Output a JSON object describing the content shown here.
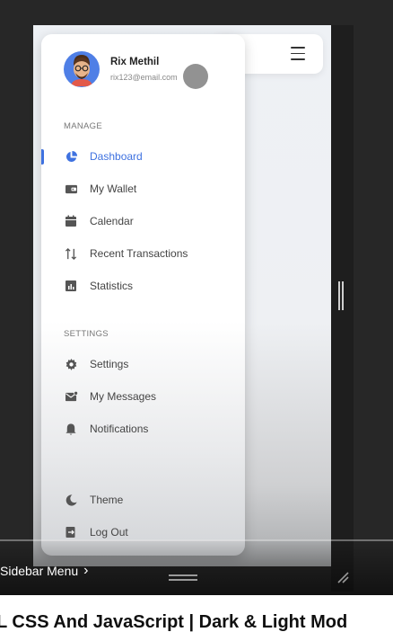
{
  "profile": {
    "name": "Rix Methil",
    "email": "rix123@email.com"
  },
  "sections": {
    "manage": "MANAGE",
    "settings": "SETTINGS"
  },
  "nav": {
    "dashboard": "Dashboard",
    "wallet": "My Wallet",
    "calendar": "Calendar",
    "transactions": "Recent Transactions",
    "statistics": "Statistics",
    "settings": "Settings",
    "messages": "My Messages",
    "notifications": "Notifications",
    "theme": "Theme",
    "logout": "Log Out"
  },
  "active_item": "Dashboard",
  "video": {
    "chapter": "Sidebar Menu",
    "caption": "L CSS And JavaScript | Dark & Light Mod"
  },
  "colors": {
    "accent": "#3f72e0",
    "avatar_bg": "#4f7fe6"
  }
}
